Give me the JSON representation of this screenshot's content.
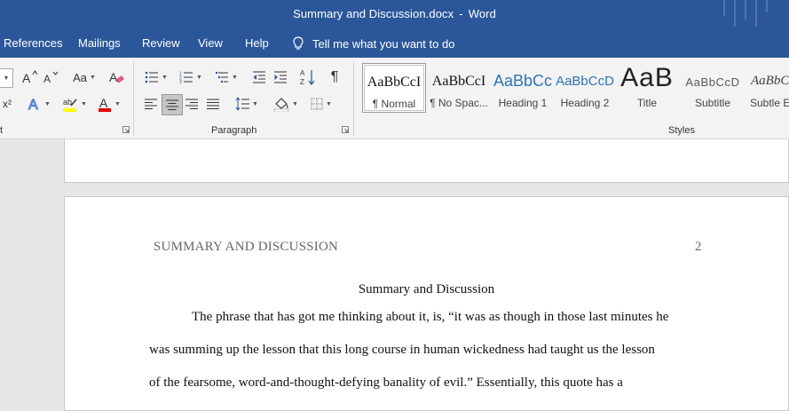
{
  "window": {
    "doc_name": "Summary and Discussion.docx",
    "separator": "-",
    "app_name": "Word",
    "accent_color": "#2b579a"
  },
  "tabs": [
    {
      "label": "References"
    },
    {
      "label": "Mailings"
    },
    {
      "label": "Review"
    },
    {
      "label": "View"
    },
    {
      "label": "Help"
    }
  ],
  "tell_me": {
    "label": "Tell me what you want to do",
    "icon": "lightbulb-icon"
  },
  "ribbon": {
    "groups": {
      "font_partial": "t",
      "paragraph": "Paragraph",
      "styles": "Styles"
    },
    "font_buttons": {
      "change_case": "Aa",
      "superscript": "x²"
    },
    "paragraph_buttons": {
      "sort": "A↓Z",
      "pilcrow": "¶"
    },
    "styles": [
      {
        "sample": "AaBbCcI",
        "name": "¶ Normal",
        "selected": true
      },
      {
        "sample": "AaBbCcI",
        "name": "¶ No Spac..."
      },
      {
        "sample": "AaBbCc",
        "name": "Heading 1"
      },
      {
        "sample": "AaBbCcD",
        "name": "Heading 2"
      },
      {
        "sample": "AaB",
        "name": "Title"
      },
      {
        "sample": "AaBbCcD",
        "name": "Subtitle"
      },
      {
        "sample": "AaBbC",
        "name": "Subtle Em"
      }
    ]
  },
  "document": {
    "running_head": "SUMMARY AND DISCUSSION",
    "page_number": "2",
    "heading": "Summary and Discussion",
    "lines": [
      "The phrase that has got me thinking about it, is, “it was as though in those last minutes he",
      "was summing up the lesson that this long course in human wickedness had taught us the lesson",
      "of the fearsome, word-and-thought-defying banality of evil.” Essentially, this quote has a"
    ]
  }
}
